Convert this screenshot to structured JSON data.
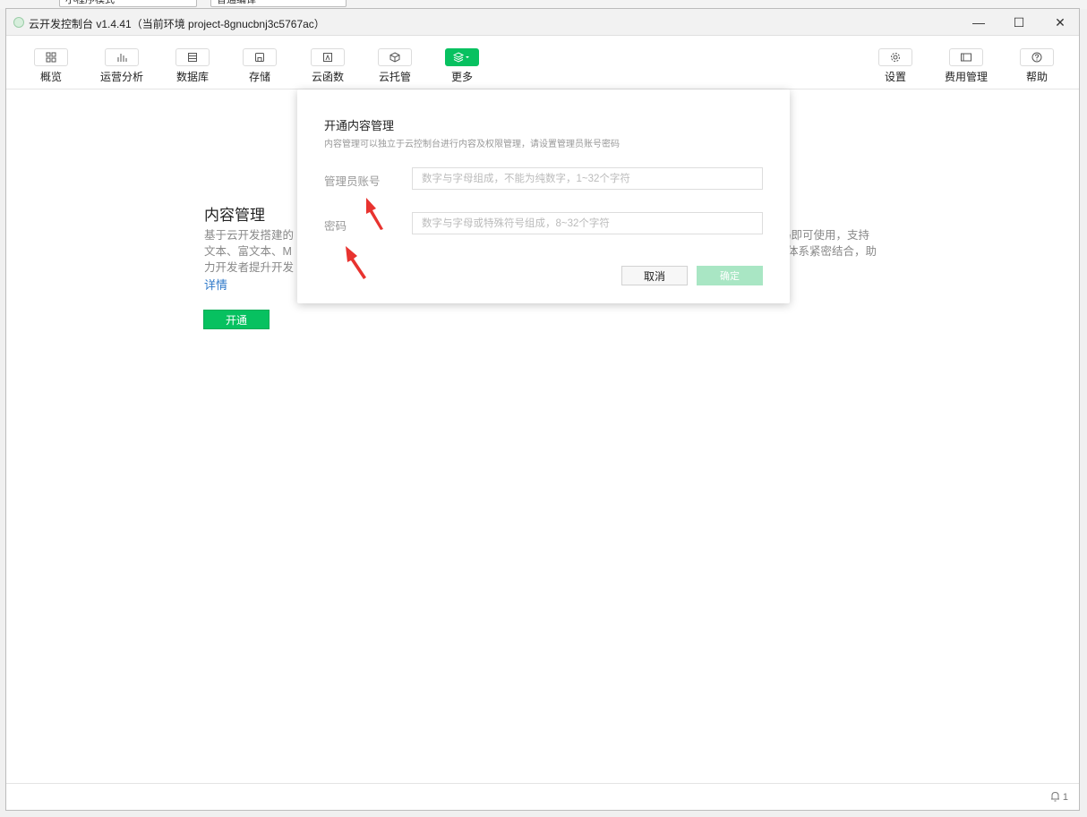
{
  "background": {
    "controls": [
      "小程序模式",
      "普通编译"
    ]
  },
  "window": {
    "title": "云开发控制台 v1.4.41（当前环境 project-8gnucbnj3c5767ac）",
    "minimize_glyph": "—",
    "maximize_glyph": "☐",
    "close_glyph": "✕"
  },
  "toolbar": {
    "left_items": [
      {
        "label": "概览",
        "icon": "grid-icon"
      },
      {
        "label": "运营分析",
        "icon": "bar-chart-icon"
      },
      {
        "label": "数据库",
        "icon": "database-icon"
      },
      {
        "label": "存储",
        "icon": "storage-icon"
      },
      {
        "label": "云函数",
        "icon": "function-icon"
      },
      {
        "label": "云托管",
        "icon": "cube-icon"
      },
      {
        "label": "更多",
        "icon": "layers-icon"
      }
    ],
    "right_items": [
      {
        "label": "设置",
        "icon": "gear-icon"
      },
      {
        "label": "费用管理",
        "icon": "billing-icon"
      },
      {
        "label": "帮助",
        "icon": "help-icon"
      }
    ]
  },
  "content": {
    "title": "内容管理",
    "desc_line1_left": "基于云开发搭建的",
    "desc_line1_right": "码即可使用，支持",
    "desc_line2_left": "文本、富文本、M",
    "desc_line2_right": "体系紧密结合，助",
    "desc_line3_left": "力开发者提升开发",
    "link": "详情",
    "open_button": "开通"
  },
  "modal": {
    "title": "开通内容管理",
    "subtitle": "内容管理可以独立于云控制台进行内容及权限管理，请设置管理员账号密码",
    "account_label": "管理员账号",
    "account_placeholder": "数字与字母组成，不能为纯数字，1~32个字符",
    "password_label": "密码",
    "password_placeholder": "数字与字母或特殊符号组成，8~32个字符",
    "cancel_label": "取消",
    "confirm_label": "确定"
  },
  "statusbar": {
    "notification_count": "1"
  },
  "colors": {
    "accent": "#07c160",
    "confirm_disabled": "#a9e6c4",
    "link": "#2f79c9",
    "annotation_arrow": "#e8332f"
  }
}
